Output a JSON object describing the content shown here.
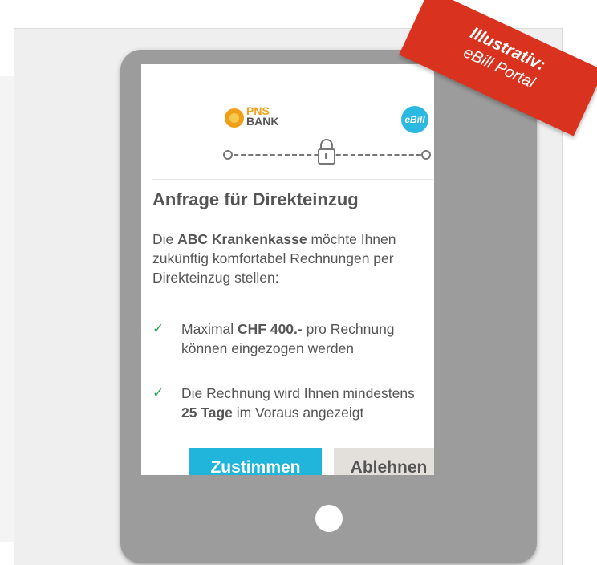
{
  "ribbon": {
    "line1": "Illustrativ:",
    "line2": "eBill Portal"
  },
  "brands": {
    "bank_top": "PNS",
    "bank_bottom": "BANK",
    "ebill": "eBill"
  },
  "icons": {
    "bank_logo": "lion-icon",
    "connection": "lock-icon",
    "check": "checkmark-icon"
  },
  "colors": {
    "accent": "#22b5dc",
    "ribbon": "#d9321e",
    "check": "#2aa84a",
    "secondary_button": "#e3e0dc"
  },
  "dialog": {
    "title": "Anfrage für Direkteinzug",
    "intro_prefix": "Die ",
    "intro_company": "ABC Krankenkasse",
    "intro_suffix": " möchte Ihnen zukünftig komfortabel Rechnungen per Direkteinzug stellen:",
    "items": [
      {
        "prefix": "Maximal ",
        "bold": "CHF 400.-",
        "suffix": " pro Rechnung können eingezogen werden"
      },
      {
        "prefix": "Die Rechnung wird Ihnen mindestens ",
        "bold": "25 Tage",
        "suffix": " im Voraus angezeigt"
      }
    ],
    "accept_label": "Zustimmen",
    "decline_label": "Ablehnen"
  }
}
